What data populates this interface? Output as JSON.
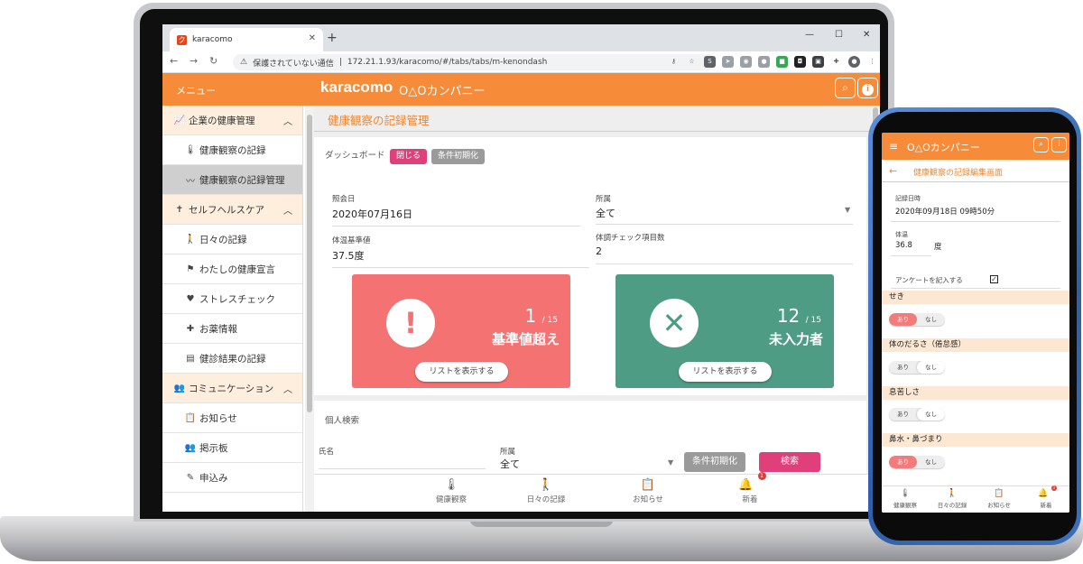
{
  "browser": {
    "tab_title": "karacomo",
    "address_warning": "保護されていない通信",
    "url": "172.21.1.93/karacomo/#/tabs/tabs/m-kenondash"
  },
  "app": {
    "menu_label": "メニュー",
    "brand": "karacomo",
    "company": "O△Oカンパニー"
  },
  "sidebar": {
    "groups": [
      {
        "label": "企業の健康管理",
        "items": [
          "健康観察の記録",
          "健康観察の記録管理"
        ]
      },
      {
        "label": "セルフヘルスケア",
        "items": [
          "日々の記録",
          "わたしの健康宣言",
          "ストレスチェック",
          "お薬情報",
          "健診結果の記録"
        ]
      },
      {
        "label": "コミュニケーション",
        "items": [
          "お知らせ",
          "掲示板",
          "申込み"
        ]
      }
    ]
  },
  "main": {
    "page_title": "健康観察の記録管理",
    "dashboard_label": "ダッシュボード",
    "close_button": "閉じる",
    "reset_button": "条件初期化",
    "fields": {
      "date_label": "照会日",
      "date_value": "2020年07月16日",
      "dept_label": "所属",
      "dept_value": "全て",
      "temp_label": "体温基準値",
      "temp_value": "37.5度",
      "check_label": "体調チェック項目数",
      "check_value": "2"
    },
    "stats": [
      {
        "count": "1",
        "total": "/ 15",
        "label": "基準値超え",
        "color": "#f47272",
        "symbol": "!"
      },
      {
        "count": "12",
        "total": "/ 15",
        "label": "未入力者",
        "color": "#4e9c83",
        "symbol": "✕"
      }
    ],
    "list_button": "リストを表示する",
    "search": {
      "title": "個人検索",
      "name_label": "氏名",
      "dept_label": "所属",
      "dept_value": "全て",
      "reset_button": "条件初期化",
      "search_button": "検索"
    }
  },
  "bottom_tabs": [
    {
      "label": "健康観察",
      "icon": "thermometer-icon"
    },
    {
      "label": "日々の記録",
      "icon": "walking-icon"
    },
    {
      "label": "お知らせ",
      "icon": "clipboard-icon"
    },
    {
      "label": "新着",
      "icon": "bell-icon",
      "badge": "1"
    }
  ],
  "phone": {
    "company": "O△Oカンパニー",
    "title": "健康観察の記録編集画面",
    "datetime_label": "記録日時",
    "datetime_value": "2020年09月18日 09時50分",
    "temp_label": "体温",
    "temp_value": "36.8",
    "temp_unit": "度",
    "survey_label": "アンケートを記入する",
    "questions": [
      {
        "label": "せき",
        "selected": "あり"
      },
      {
        "label": "体のだるさ（倦怠感）",
        "selected": "なし"
      },
      {
        "label": "息苦しさ",
        "selected": "なし"
      },
      {
        "label": "鼻水・鼻づまり",
        "selected": "あり"
      }
    ],
    "yes": "あり",
    "no": "なし",
    "tabs": [
      "健康観察",
      "日々の記録",
      "お知らせ",
      "新着"
    ],
    "badge": "3"
  },
  "colors": {
    "accent": "#f68b3a",
    "alert": "#f47272",
    "teal": "#4e9c83",
    "pink": "#e0407a"
  }
}
